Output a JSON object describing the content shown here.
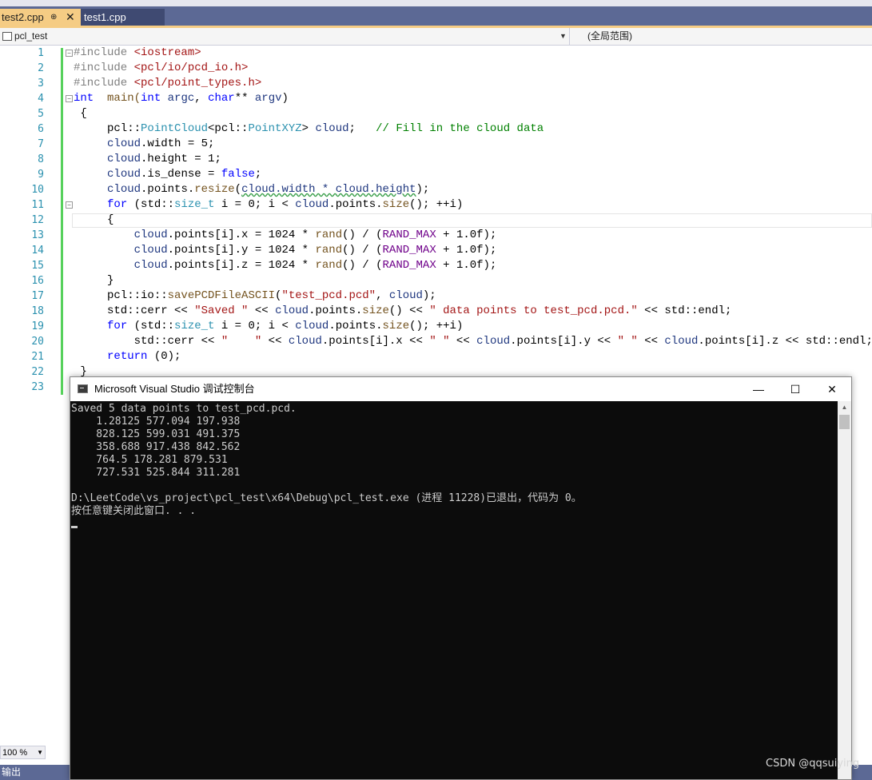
{
  "tabs": {
    "active": "test2.cpp",
    "active_pin": "⊕",
    "active_close": "✕",
    "inactive": "test1.cpp"
  },
  "navbar": {
    "project": "pcl_test",
    "scope": "(全局范围)"
  },
  "editor": {
    "line_numbers": [
      "1",
      "2",
      "3",
      "4",
      "5",
      "6",
      "7",
      "8",
      "9",
      "10",
      "11",
      "12",
      "13",
      "14",
      "15",
      "16",
      "17",
      "18",
      "19",
      "20",
      "21",
      "22",
      "23"
    ],
    "code": {
      "l1a": "#include ",
      "l1b": "<iostream>",
      "l2a": "#include ",
      "l2b": "<pcl/io/pcd_io.h>",
      "l3a": "#include ",
      "l3b": "<pcl/point_types.h>",
      "l4_int": "int",
      "l4_main": "  main(",
      "l4_int2": "int",
      "l4_argc": " argc",
      "l4_comma": ", ",
      "l4_char": "char",
      "l4_rest": "** ",
      "l4_argv": "argv",
      "l4_close": ")",
      "l5": " {",
      "l6a": "     pcl::",
      "l6b": "PointCloud",
      "l6c": "<pcl::",
      "l6d": "PointXYZ",
      "l6e": "> ",
      "l6f": "cloud",
      "l6g": ";   ",
      "l6h": "// Fill in the cloud data",
      "l7a": "     ",
      "l7b": "cloud",
      "l7c": ".width = 5;",
      "l8a": "     ",
      "l8b": "cloud",
      "l8c": ".height = 1;",
      "l9a": "     ",
      "l9b": "cloud",
      "l9c": ".is_dense = ",
      "l9d": "false",
      "l9e": ";",
      "l10a": "     ",
      "l10b": "cloud",
      "l10c": ".points.",
      "l10d": "resize",
      "l10e": "(",
      "l10f": "cloud.width * cloud.height",
      "l10g": ");",
      "l11a": "     ",
      "l11b": "for",
      "l11c": " (std::",
      "l11d": "size_t",
      "l11e": " i = 0; i < ",
      "l11f": "cloud",
      "l11g": ".points.",
      "l11h": "size",
      "l11i": "(); ++i)",
      "l12": "     {",
      "l13a": "         ",
      "l13b": "cloud",
      "l13c": ".points[i].x = 1024 * ",
      "l13d": "rand",
      "l13e": "() / (",
      "l13f": "RAND_MAX",
      "l13g": " + 1.0f);",
      "l14a": "         ",
      "l14b": "cloud",
      "l14c": ".points[i].y = 1024 * ",
      "l14d": "rand",
      "l14e": "() / (",
      "l14f": "RAND_MAX",
      "l14g": " + 1.0f);",
      "l15a": "         ",
      "l15b": "cloud",
      "l15c": ".points[i].z = 1024 * ",
      "l15d": "rand",
      "l15e": "() / (",
      "l15f": "RAND_MAX",
      "l15g": " + 1.0f);",
      "l16": "     }",
      "l17a": "     pcl::io::",
      "l17b": "savePCDFileASCII",
      "l17c": "(",
      "l17d": "\"test_pcd.pcd\"",
      "l17e": ", ",
      "l17f": "cloud",
      "l17g": ");",
      "l18a": "     std::cerr << ",
      "l18b": "\"Saved \"",
      "l18c": " << ",
      "l18d": "cloud",
      "l18e": ".points.",
      "l18f": "size",
      "l18g": "() << ",
      "l18h": "\" data points to test_pcd.pcd.\"",
      "l18i": " << std::endl;",
      "l19a": "     ",
      "l19b": "for",
      "l19c": " (std::",
      "l19d": "size_t",
      "l19e": " i = 0; i < ",
      "l19f": "cloud",
      "l19g": ".points.",
      "l19h": "size",
      "l19i": "(); ++i)",
      "l20a": "         std::cerr << ",
      "l20b": "\"    \"",
      "l20c": " << ",
      "l20d": "cloud",
      "l20e": ".points[i].x << ",
      "l20f": "\" \"",
      "l20g": " << ",
      "l20h": "cloud",
      "l20i": ".points[i].y << ",
      "l20j": "\" \"",
      "l20k": " << ",
      "l20l": "cloud",
      "l20m": ".points[i].z << std::endl;",
      "l21a": "     ",
      "l21b": "return",
      "l21c": " (0);",
      "l22": " }"
    }
  },
  "status": {
    "zoom": "100 %",
    "output_label": "输出"
  },
  "console": {
    "title": "Microsoft Visual Studio 调试控制台",
    "minimize": "—",
    "maximize": "☐",
    "close": "✕",
    "lines": [
      "Saved 5 data points to test_pcd.pcd.",
      "    1.28125 577.094 197.938",
      "    828.125 599.031 491.375",
      "    358.688 917.438 842.562",
      "    764.5 178.281 879.531",
      "    727.531 525.844 311.281",
      "",
      "D:\\LeetCode\\vs_project\\pcl_test\\x64\\Debug\\pcl_test.exe (进程 11228)已退出，代码为 0。",
      "按任意键关闭此窗口. . ."
    ]
  },
  "watermark": "CSDN @qqsuiying"
}
